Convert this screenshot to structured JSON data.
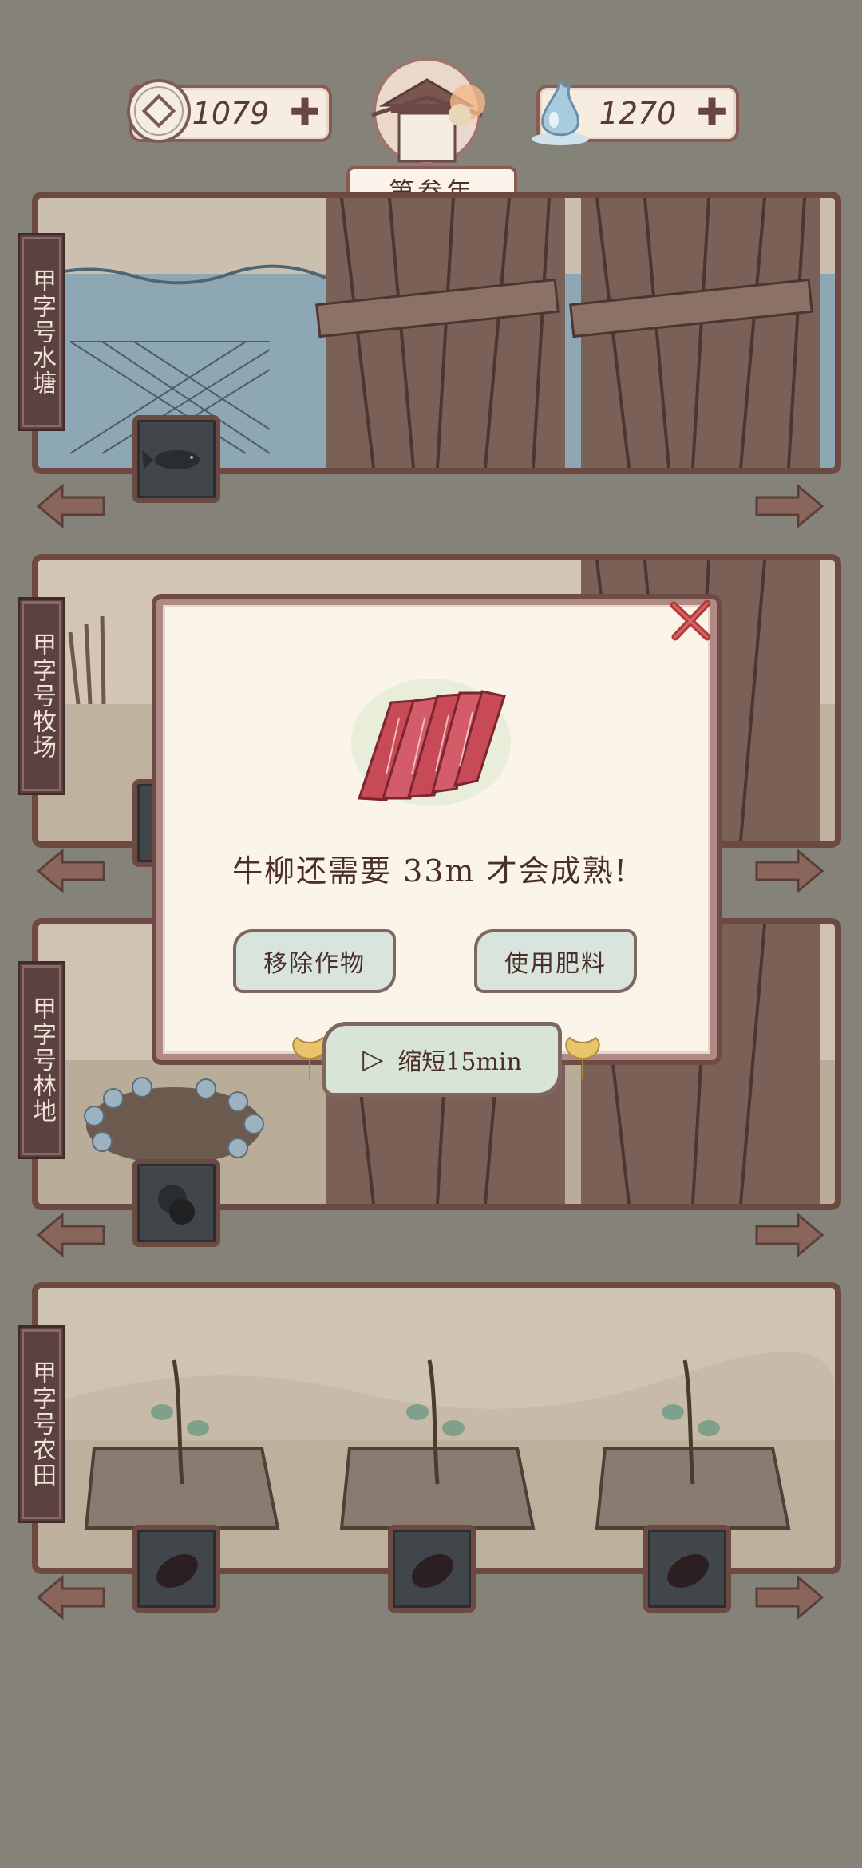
{
  "header": {
    "coins": "1079",
    "water": "1270",
    "year": "第叁年"
  },
  "plots": [
    {
      "label": "甲字号水塘",
      "icon": "fish-icon"
    },
    {
      "label": "甲字号牧场",
      "icon": "cow-icon"
    },
    {
      "label": "甲字号林地",
      "icon": "chestnut-icon"
    },
    {
      "label": "甲字号农田",
      "icon": "sweet-potato-icon"
    }
  ],
  "modal": {
    "message": "牛柳还需要 33m 才会成熟!",
    "remove_label": "移除作物",
    "fertilize_label": "使用肥料",
    "speedup_label": "缩短15min"
  },
  "colors": {
    "background": "#85827a",
    "frame": "#6c4a42",
    "panel": "#fbf4e8",
    "button": "#d9e4dc"
  }
}
